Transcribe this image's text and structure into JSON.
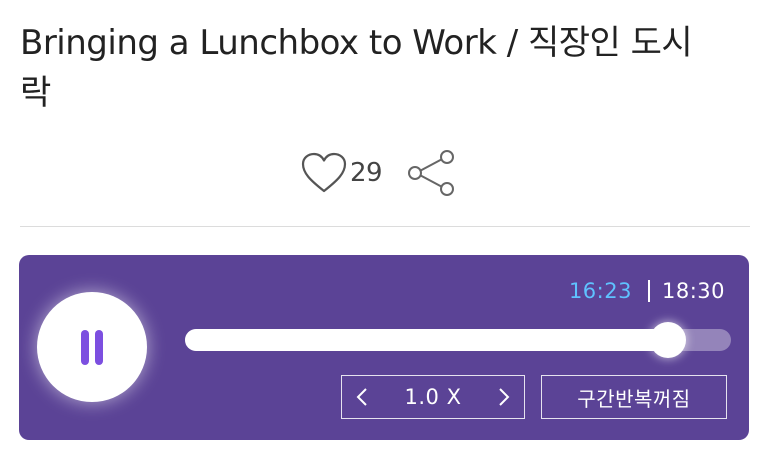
{
  "article": {
    "title": "Bringing a Lunchbox to Work / 직장인 도시락"
  },
  "actions": {
    "like_count": "29",
    "like_icon": "heart-outline-icon",
    "share_icon": "share-icon"
  },
  "player": {
    "state": "playing",
    "current_time": "16:23",
    "total_time": "18:30",
    "progress": 0.885,
    "speed_label": "1.0 X",
    "repeat_label": "구간반복꺼짐",
    "colors": {
      "background": "#5b4396",
      "time_current": "#5fc2ff",
      "pause_icon": "#7c4fe0"
    }
  }
}
